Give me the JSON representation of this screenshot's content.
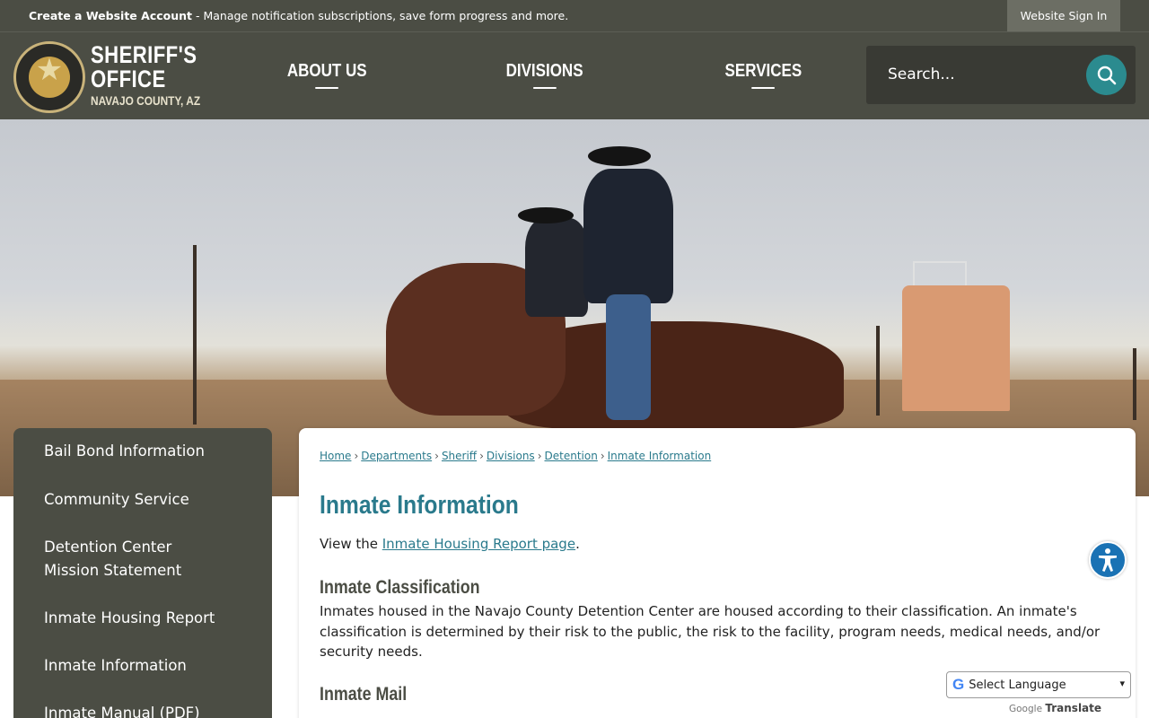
{
  "topbar": {
    "create_account": "Create a Website Account",
    "message": " - Manage notification subscriptions, save form progress and more.",
    "sign_in": "Website Sign In"
  },
  "logo": {
    "line1": "SHERIFF'S",
    "line2": "OFFICE",
    "line3": "NAVAJO COUNTY, AZ",
    "icon": "sheriff-badge-icon"
  },
  "nav": {
    "items": [
      {
        "label": "ABOUT US"
      },
      {
        "label": "DIVISIONS"
      },
      {
        "label": "SERVICES"
      }
    ]
  },
  "search": {
    "placeholder": "Search...",
    "icon": "search-icon"
  },
  "sidebar": {
    "items": [
      {
        "label": "Bail Bond Information"
      },
      {
        "label": "Community Service"
      },
      {
        "label": "Detention Center Mission Statement"
      },
      {
        "label": "Inmate Housing Report"
      },
      {
        "label": "Inmate Information"
      },
      {
        "label": "Inmate Manual (PDF)"
      }
    ]
  },
  "breadcrumb": {
    "items": [
      "Home",
      "Departments",
      "Sheriff",
      "Divisions",
      "Detention",
      "Inmate Information"
    ],
    "separator": "›"
  },
  "main": {
    "title": "Inmate Information",
    "intro_prefix": "View the ",
    "intro_link": "Inmate Housing Report page",
    "intro_suffix": ".",
    "section1_heading": "Inmate Classification",
    "section1_body": "Inmates housed in the Navajo County Detention Center are housed according to their classification. An inmate's classification is determined by their risk to the public, the risk to the facility, program needs, medical needs, and/or security needs.",
    "section2_heading": "Inmate Mail"
  },
  "translate": {
    "select_label": "Select Language",
    "powered_by": "Google",
    "translate_label": "Translate"
  },
  "colors": {
    "header_bg": "#4b4d44",
    "accent_teal": "#2a7a8c",
    "search_button": "#2b8b8f",
    "accessibility_blue": "#1a72b4"
  }
}
